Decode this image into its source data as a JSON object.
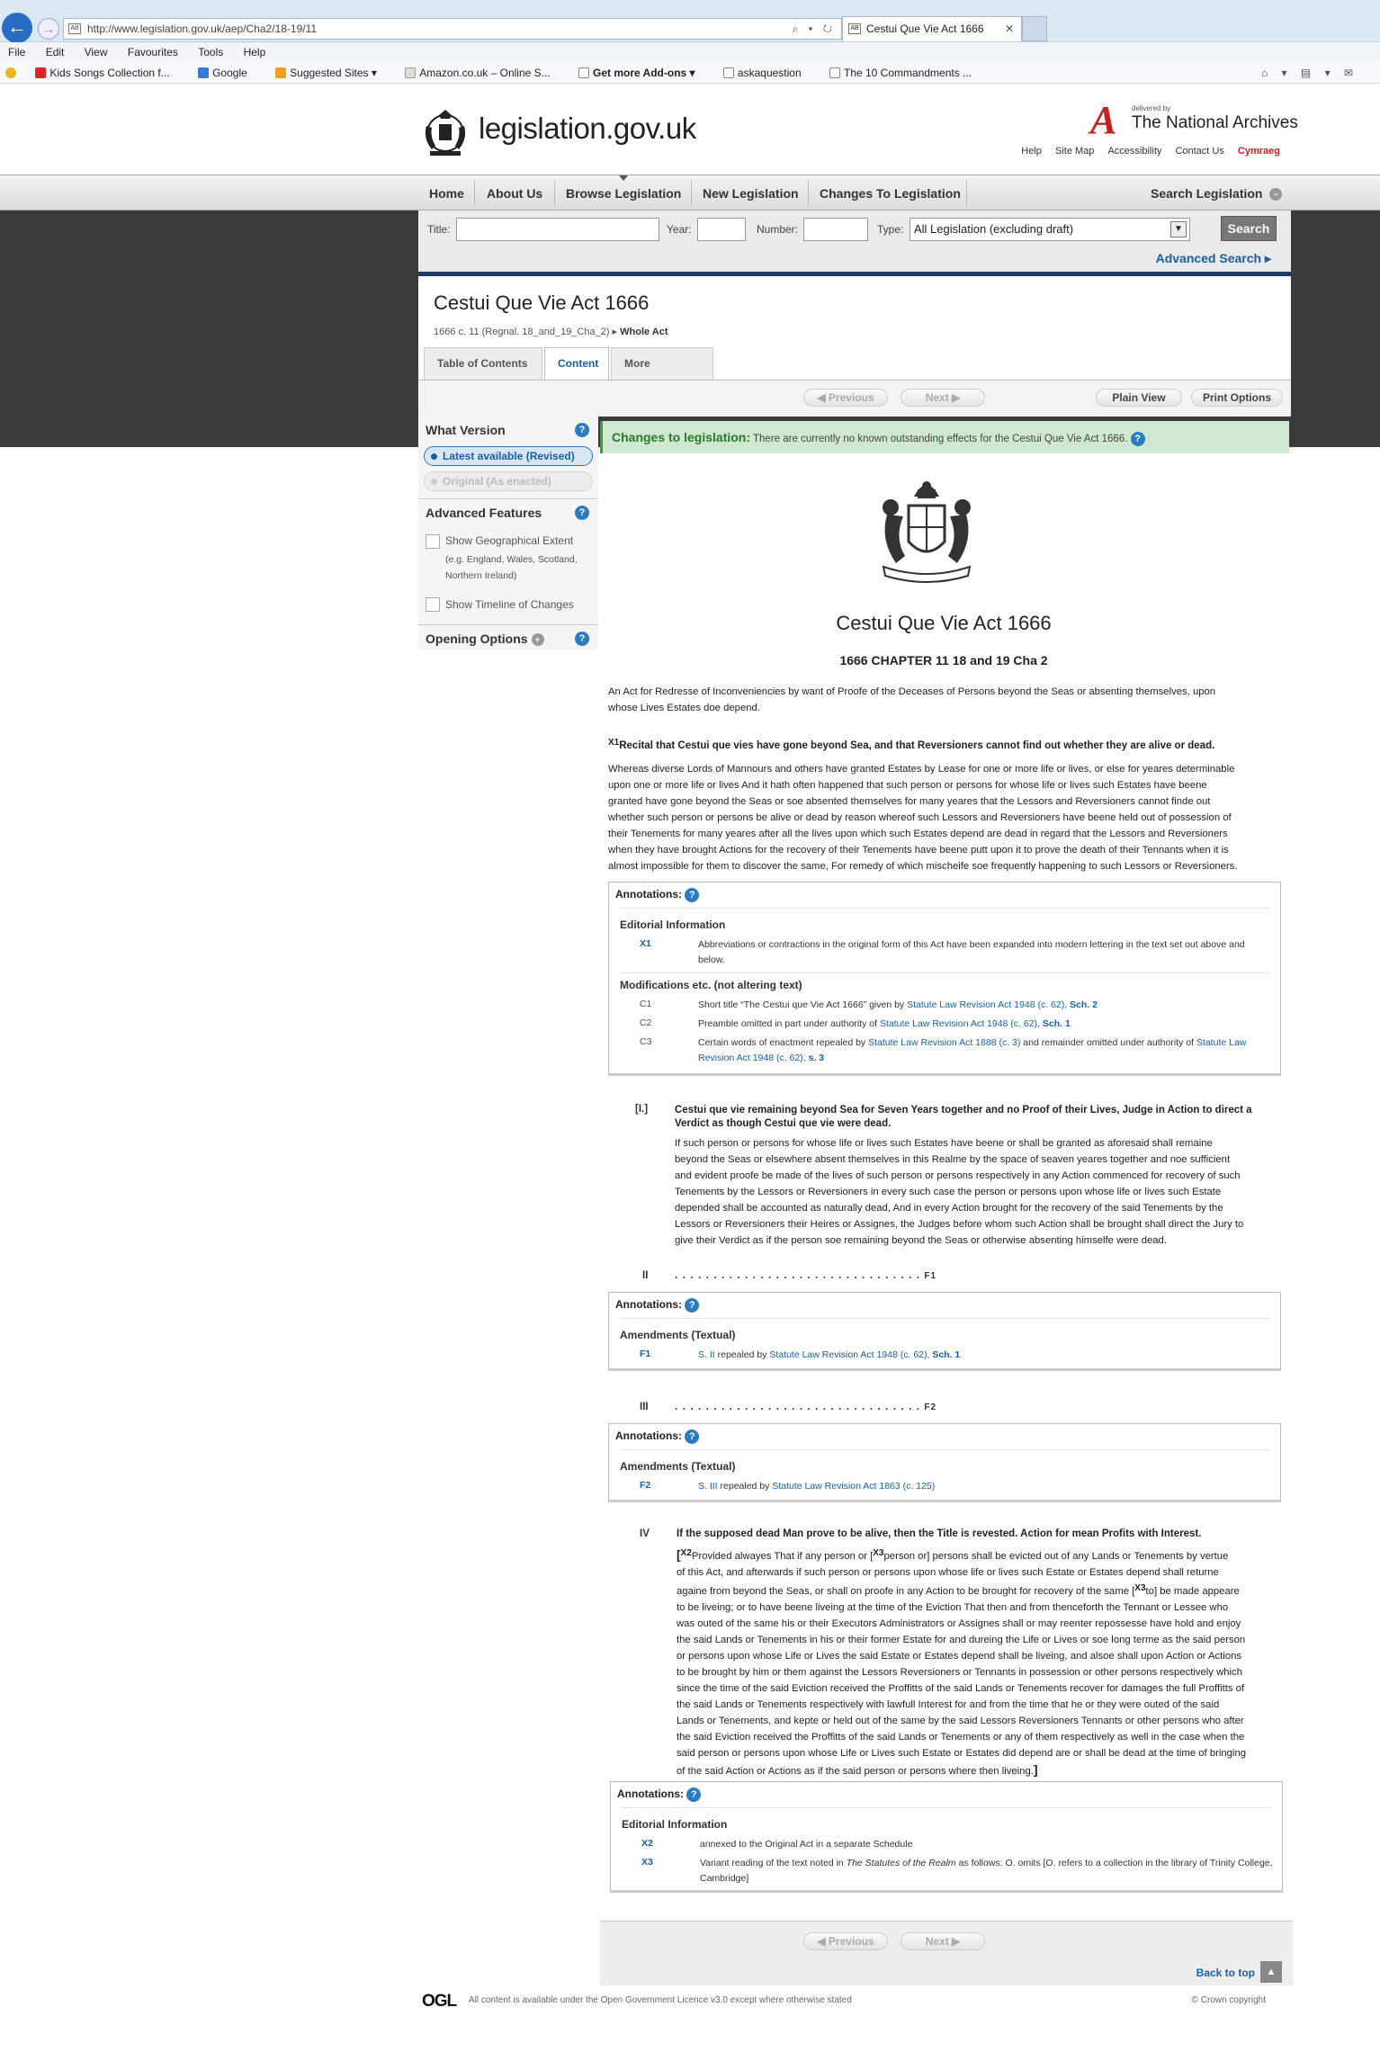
{
  "browser": {
    "url": "http://www.legislation.gov.uk/aep/Cha2/18-19/11",
    "address_tools": "⌕ ▾ ↻",
    "tab_title": "Cestui Que Vie Act 1666",
    "tab_close": "✕",
    "menu": [
      "File",
      "Edit",
      "View",
      "Favourites",
      "Tools",
      "Help"
    ],
    "favourites": [
      "Kids Songs Collection f...",
      "Google",
      "Suggested Sites ▾",
      "Amazon.co.uk – Online S...",
      "Get more Add-ons ▾",
      "askaquestion",
      "The 10 Commandments ..."
    ],
    "favourites_right": "⌂ ▾ ▤ ▾ ✉"
  },
  "header": {
    "site_name": "legislation.gov.uk",
    "tna_letter": "A",
    "tna_delivered": "delivered by",
    "tna_name": "The National Archives",
    "links": [
      "Help",
      "Site Map",
      "Accessibility",
      "Contact Us"
    ],
    "cymraeg": "Cymraeg"
  },
  "nav": {
    "items": [
      "Home",
      "About Us",
      "Browse Legislation",
      "New Legislation",
      "Changes To Legislation"
    ],
    "search_legislation": "Search Legislation"
  },
  "search": {
    "title_label": "Title:",
    "title_value": "",
    "year_label": "Year:",
    "year_value": "",
    "number_label": "Number:",
    "number_value": "",
    "type_label": "Type:",
    "type_value": "All Legislation (excluding draft)",
    "search_button": "Search",
    "advanced_search": "Advanced Search ▸"
  },
  "document": {
    "title": "Cestui Que Vie Act 1666",
    "citation": "1666 c. 11 (Regnal. 18_and_19_Cha_2) ▸",
    "whole_act": "Whole Act",
    "tabs": [
      "Table of Contents",
      "Content",
      "More Resources"
    ],
    "previous": "◀ Previous",
    "next": "Next ▶",
    "plain_view": "Plain View",
    "print_options": "Print Options"
  },
  "sidebar": {
    "what_version": "What Version",
    "latest": "Latest available (Revised)",
    "original": "Original (As enacted)",
    "advanced_features": "Advanced Features",
    "show_geo": "Show Geographical Extent",
    "geo_note_1": "(e.g. England, Wales, Scotland,",
    "geo_note_2": "Northern Ireland)",
    "show_timeline": "Show Timeline of Changes",
    "opening_options": "Opening Options"
  },
  "content": {
    "changes_label": "Changes to legislation:",
    "changes_text": "There are currently no known outstanding effects for the Cestui Que Vie Act 1666.",
    "act_title": "Cestui Que Vie Act 1666",
    "chapter": "1666 CHAPTER 11 18 and 19 Cha 2",
    "long_title_1": "An Act for Redresse of Inconveniencies by want of Proofe of the Deceases of Persons beyond the Seas or absenting themselves, upon",
    "long_title_2": "whose Lives Estates doe depend.",
    "recital_marker": "X1",
    "recital_heading": "Recital that Cestui que vies have gone beyond Sea, and that Reversioners cannot find out whether they are alive or dead.",
    "recital_lines": [
      "Whereas diverse Lords of Mannours and others have granted Estates by Lease for one or more life or lives, or else for yeares determinable",
      "upon one or more life or lives And it hath often happened that such person or persons for whose life or lives such Estates have beene",
      "granted have gone beyond the Seas or soe absented themselves for many yeares that the Lessors and Reversioners cannot finde out",
      "whether such person or persons be alive or dead by reason whereof such Lessors and Reversioners have beene held out of possession of",
      "their Tenements for many yeares after all the lives upon which such Estates depend are dead in regard that the Lessors and Reversioners",
      "when they have brought Actions for the recovery of their Tenements have beene putt upon it to prove the death of their Tennants when it is",
      "almost impossible for them to discover the same, For remedy of which mischeife soe frequently happening to such Lessors or Reversioners."
    ],
    "annotations_label": "Annotations:",
    "annot1": {
      "editorial": "Editorial Information",
      "x1_code": "X1",
      "x1_text_1": "Abbreviations or contractions in the original form of this Act have been expanded into modern lettering in the text set out above and",
      "x1_text_2": "below.",
      "mods": "Modifications etc. (not altering text)",
      "c1_code": "C1",
      "c1_pre": "Short title “The Cestui que Vie Act 1666” given by",
      "c1_link": "Statute Law Revision Act 1948 (c. 62),",
      "c1_sch": "Sch. 2",
      "c2_code": "C2",
      "c2_pre": "Preamble omitted in part under authority of",
      "c2_link": "Statute Law Revision Act 1948 (c. 62),",
      "c2_sch": "Sch. 1",
      "c3_code": "C3",
      "c3_pre": "Certain words of enactment repealed by",
      "c3_link1": "Statute Law Revision Act 1888 (c. 3)",
      "c3_mid": "and remainder omitted under authority of",
      "c3_link2a": "Statute Law",
      "c3_link2b": "Revision Act 1948 (c. 62),",
      "c3_sch": "s. 3"
    },
    "s1": {
      "num": "[I.]",
      "heading_1": "Cestui que vie remaining beyond Sea for Seven Years together and no Proof of their Lives, Judge in Action to direct a",
      "heading_2": "Verdict as though Cestui que vie were dead.",
      "lines": [
        "If such person or persons for whose life or lives such Estates have beene or shall be granted as aforesaid shall remaine",
        "beyond the Seas or elsewhere absent themselves in this Realme by the space of seaven yeares together and noe sufficient",
        "and evident proofe be made of the lives of such person or persons respectively in any Action commenced for recovery of such",
        "Tenements by the Lessors or Reversioners in every such case the person or persons upon whose life or lives such Estate",
        "depended shall be accounted as naturally dead, And in every Action brought for the recovery of the said Tenements by the",
        "Lessors or Reversioners their Heires or Assignes, the Judges before whom such Action shall be brought shall direct the Jury to",
        "give their Verdict as if the person soe remaining beyond the Seas or otherwise absenting himselfe were dead."
      ]
    },
    "s2": {
      "num": "II",
      "dots": ". . . . . . . . . . . . . . . . . . . . . . . . . . . . . . . .",
      "ref": "F1",
      "amend": "Amendments (Textual)",
      "code": "F1",
      "pre": "S. II",
      "mid": "repealed by",
      "link": "Statute Law Revision Act 1948 (c. 62),",
      "sch": "Sch. 1"
    },
    "s3": {
      "num": "III",
      "dots": ". . . . . . . . . . . . . . . . . . . . . . . . . . . . . . . .",
      "ref": "F2",
      "amend": "Amendments (Textual)",
      "code": "F2",
      "pre": "S. III",
      "mid": "repealed by",
      "link": "Statute Law Revision Act 1863 (c. 125)"
    },
    "s4": {
      "num": "IV",
      "heading": "If the supposed dead Man prove to be alive, then the Title is revested. Action for mean Profits with Interest.",
      "open_bracket": "[",
      "x2": "X2",
      "line1_a": "Provided alwayes That if any person or [",
      "x3a": "X3",
      "line1_b": "person or] persons shall be evicted out of any Lands or Tenements by vertue",
      "line2": "of this Act, and afterwards if such person or persons upon whose life or lives such Estate or Estates depend shall returne",
      "line3_a": "againe from beyond the Seas, or shall on proofe in any Action to be brought for recovery of the same [",
      "x3b": "X3",
      "line3_b": "to] be made appeare",
      "lines": [
        "to be liveing; or to have beene liveing at the time of the Eviction That then and from thenceforth the Tennant or Lessee who",
        "was outed of the same his or their Executors Administrators or Assignes shall or may reenter repossesse have hold and enjoy",
        "the said Lands or Tenements in his or their former Estate for and dureing the Life or Lives or soe long terme as the said person",
        "or persons upon whose Life or Lives the said Estate or Estates depend shall be liveing, and alsoe shall upon Action or Actions",
        "to be brought by him or them against the Lessors Reversioners or Tennants in possession or other persons respectively which",
        "since the time of the said Eviction received the Proffitts of the said Lands or Tenements recover for damages the full Proffitts of",
        "the said Lands or Tenements respectively with lawfull Interest for and from the time that he or they were outed of the said",
        "Lands or Tenements, and kepte or held out of the same by the said Lessors Reversioners Tennants or other persons who after",
        "the said Eviction received the Proffitts of the said Lands or Tenements or any of them respectively as well in the case when the",
        "said person or persons upon whose Life or Lives such Estate or Estates did depend are or shall be dead at the time of bringing"
      ],
      "last_line": "of the said Action or Actions as if the said person or persons where then liveing.",
      "close_bracket": "]",
      "editorial": "Editorial Information",
      "x2_code": "X2",
      "x2_text": "annexed to the Original Act in a separate Schedule",
      "x3_code": "X3",
      "x3_text_a": "Variant reading of the text noted in",
      "x3_text_i": "The Statutes of the Realm",
      "x3_text_b": "as follows: O. omits [O. refers to a collection in the library of Trinity College,",
      "x3_text_2": "Cambridge]"
    },
    "back_to_top": "Back to top",
    "back_to_top_icon": "▲"
  },
  "footer": {
    "logo": "OGL",
    "text": "All content is available under the Open Government Licence v3.0 except where otherwise stated",
    "copyright": "© Crown copyright"
  }
}
